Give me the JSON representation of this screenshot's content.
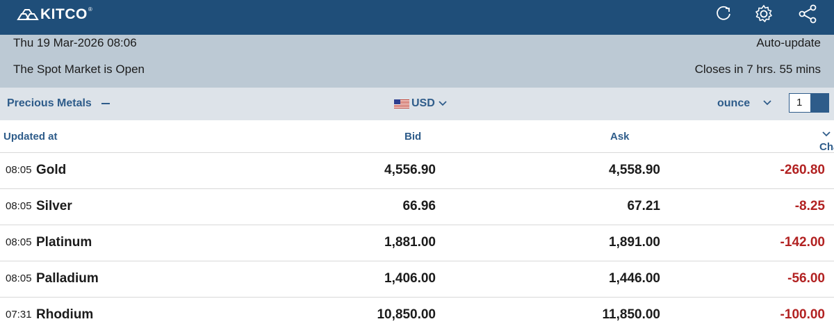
{
  "header": {
    "logo_text": "KITCO",
    "logo_mark": "®",
    "icons": [
      "refresh-icon",
      "gear-icon",
      "share-icon"
    ],
    "bg_color": "#1f4e79"
  },
  "status": {
    "datetime": "Thu 19 Mar-2026 08:06",
    "auto_update": "Auto-update",
    "market_status": "The Spot Market is Open",
    "closes_in": "Closes in 7 hrs. 55 mins"
  },
  "controls": {
    "category": "Precious Metals",
    "currency": "USD",
    "unit": "ounce",
    "quantity": "1"
  },
  "table": {
    "headers": {
      "updated": "Updated at",
      "bid": "Bid",
      "ask": "Ask",
      "change": "Change"
    },
    "rows": [
      {
        "time": "08:05",
        "name": "Gold",
        "bid": "4,556.90",
        "ask": "4,558.90",
        "change": "-260.80"
      },
      {
        "time": "08:05",
        "name": "Silver",
        "bid": "66.96",
        "ask": "67.21",
        "change": "-8.25"
      },
      {
        "time": "08:05",
        "name": "Platinum",
        "bid": "1,881.00",
        "ask": "1,891.00",
        "change": "-142.00"
      },
      {
        "time": "08:05",
        "name": "Palladium",
        "bid": "1,406.00",
        "ask": "1,446.00",
        "change": "-56.00"
      },
      {
        "time": "07:31",
        "name": "Rhodium",
        "bid": "10,850.00",
        "ask": "11,850.00",
        "change": "-100.00"
      }
    ]
  },
  "colors": {
    "negative": "#b22222",
    "accent": "#2e5c8a"
  }
}
